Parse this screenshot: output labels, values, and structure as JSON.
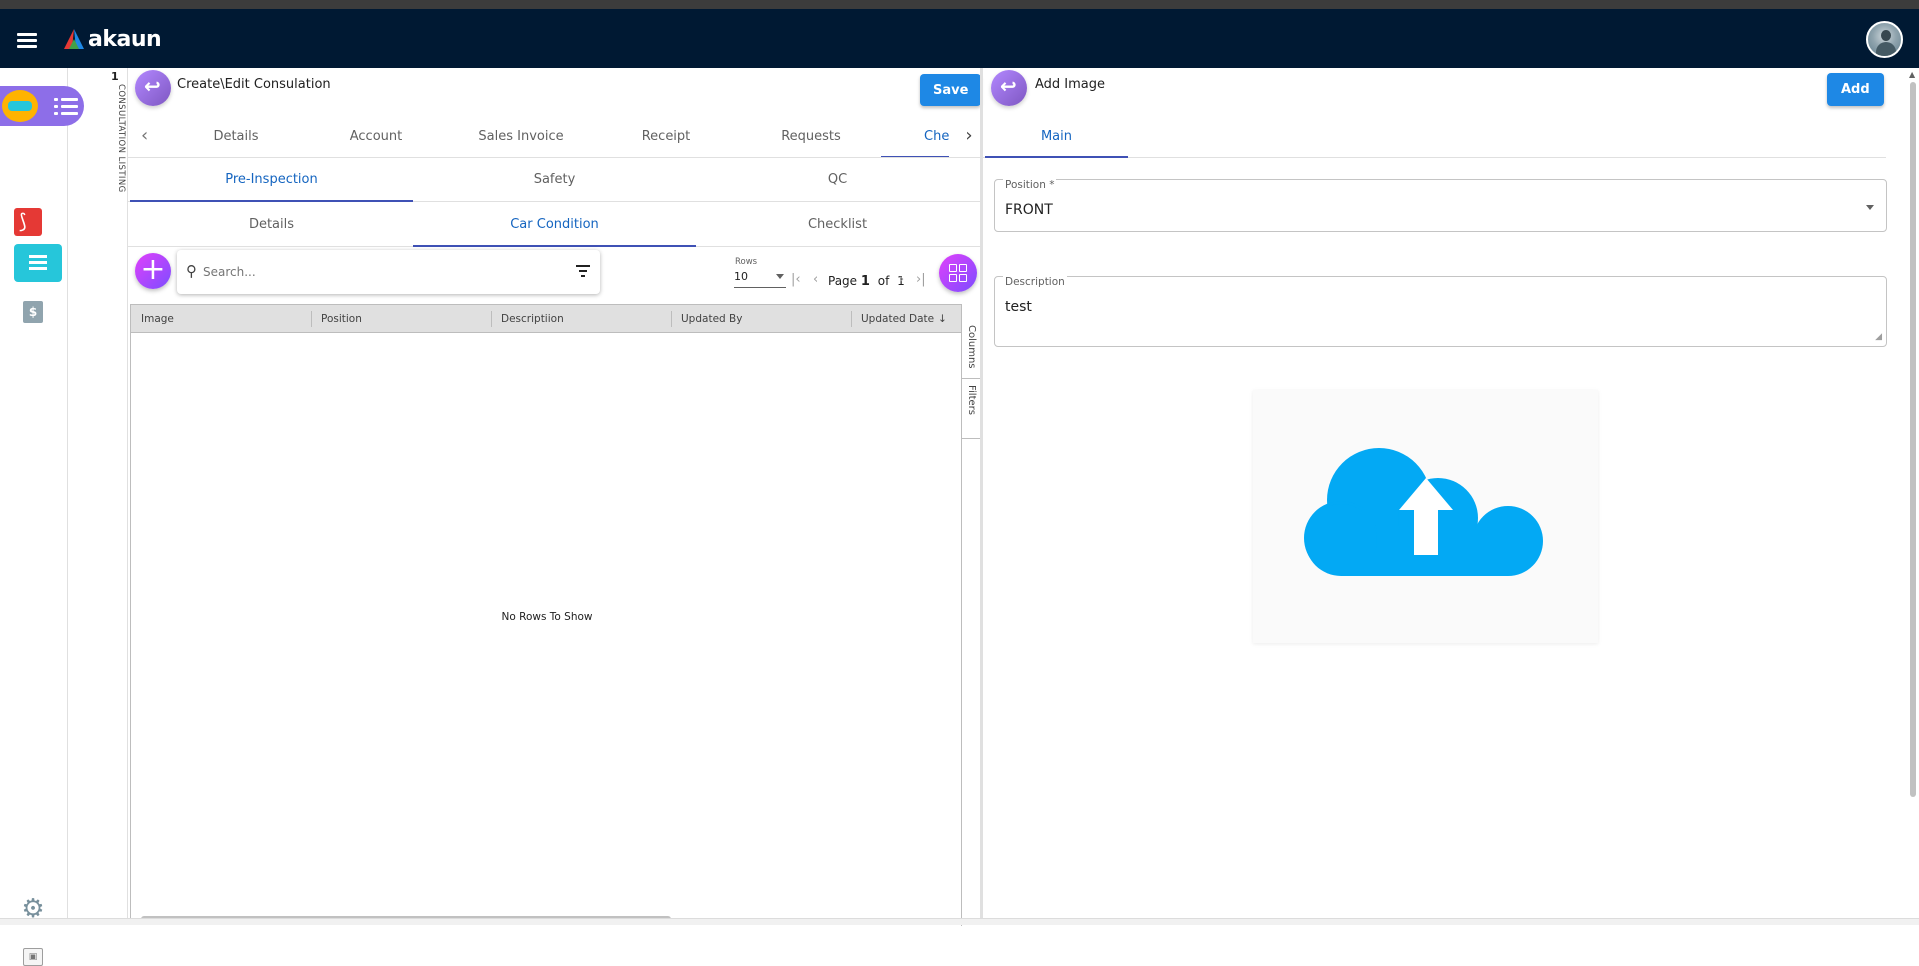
{
  "header": {
    "brand": "akaun",
    "brand_colors": [
      "#e53935",
      "#1e88e5",
      "#43a047"
    ]
  },
  "sidebar": {
    "items": [
      {
        "icon": "car-app-icon"
      },
      {
        "icon": "pdf-icon"
      },
      {
        "icon": "list-icon"
      },
      {
        "icon": "dollar-document-icon",
        "label": "$"
      },
      {
        "icon": "gear-icon"
      }
    ]
  },
  "vertical_tab": {
    "number": "1",
    "label": "CONSULTATION LISTING"
  },
  "left_panel": {
    "title": "Create\\Edit Consulation",
    "save_label": "Save",
    "tabs": [
      "Details",
      "Account",
      "Sales Invoice",
      "Receipt",
      "Requests",
      "Che"
    ],
    "active_tab": "Che",
    "sub_tabs": [
      "Pre-Inspection",
      "Safety",
      "QC"
    ],
    "active_sub_tab": "Pre-Inspection",
    "sub_sub_tabs": [
      "Details",
      "Car Condition",
      "Checklist"
    ],
    "active_sub_sub_tab": "Car Condition",
    "search": {
      "placeholder": "Search..."
    },
    "pagination": {
      "rows_label": "Rows",
      "rows_value": "10",
      "page_label": "Page",
      "page": "1",
      "of_label": "of",
      "total_pages": "1"
    },
    "grid": {
      "columns": [
        "Image",
        "Position",
        "Descriptiion",
        "Updated By",
        "Updated Date"
      ],
      "sort_indicator": "↓",
      "empty_text": "No Rows To Show",
      "side_tools": [
        "Columns",
        "Filters"
      ]
    }
  },
  "right_panel": {
    "title": "Add Image",
    "add_label": "Add",
    "tabs": [
      "Main"
    ],
    "active_tab": "Main",
    "position": {
      "label": "Position *",
      "value": "FRONT"
    },
    "description": {
      "label": "Description",
      "value": "test"
    },
    "upload": {
      "icon": "cloud-upload-icon",
      "color": "#03a9f4"
    }
  },
  "colors": {
    "topbar": "#001933",
    "primary_button": "#1e88e5",
    "active_tab_underline": "#3f51b5",
    "accent_purple": "#7c4dff"
  }
}
